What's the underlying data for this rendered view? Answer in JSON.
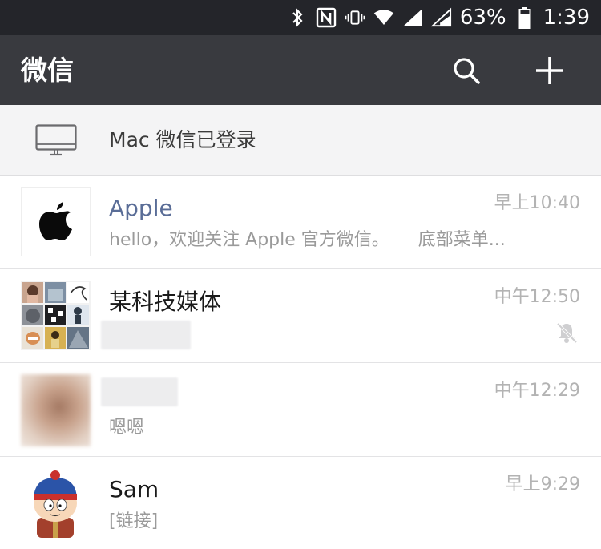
{
  "status_bar": {
    "battery_percent": "63%",
    "time": "1:39",
    "icons": [
      "bluetooth-icon",
      "nfc-icon",
      "vibrate-icon",
      "wifi-icon",
      "signal-icon",
      "signal-2-icon",
      "battery-icon"
    ]
  },
  "header": {
    "title": "微信",
    "icons": [
      "search-icon",
      "plus-icon"
    ]
  },
  "login_banner": {
    "icon": "monitor-icon",
    "text": "Mac 微信已登录"
  },
  "chats": [
    {
      "name": "Apple",
      "time": "早上10:40",
      "preview": "hello，欢迎关注 Apple 官方微信。",
      "preview_tail": "底部菜单...",
      "avatar_icon": "apple-logo-icon"
    },
    {
      "name": "某科技媒体",
      "time": "中午12:50",
      "preview": "",
      "muted_icon": "bell-muted-icon",
      "avatar_icon": "photo-grid-avatar"
    },
    {
      "name": "",
      "time": "中午12:29",
      "preview": "嗯嗯",
      "avatar_icon": "blurred-photo-avatar"
    },
    {
      "name": "Sam",
      "time": "早上9:29",
      "preview": "[链接]",
      "avatar_icon": "cartoon-boy-avatar"
    }
  ],
  "colors": {
    "status_bar_bg": "#24252a",
    "title_bar_bg": "#393a3f",
    "banner_bg": "#f4f4f5",
    "official_name": "#5a6d97",
    "time_text": "#b3b3b3",
    "preview_text": "#9a9a9a"
  }
}
